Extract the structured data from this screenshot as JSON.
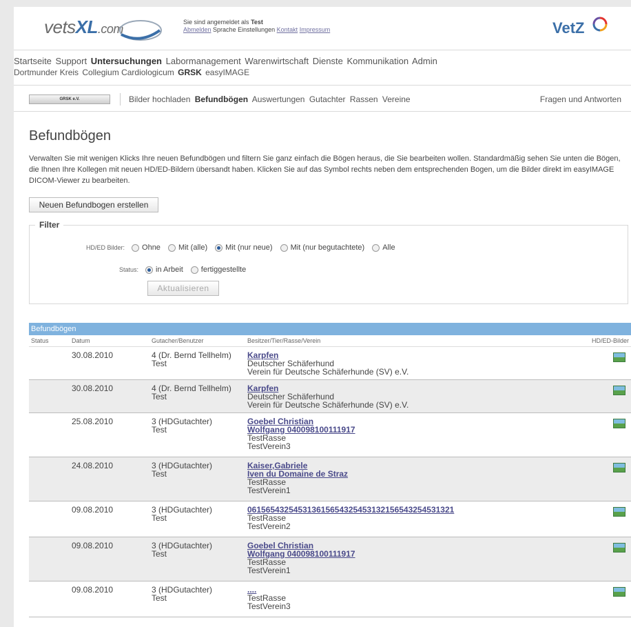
{
  "header": {
    "logo_main": "vets",
    "logo_bold": "XL",
    "logo_suffix": ".com",
    "session_prefix": "Sie sind angemeldet als",
    "session_user": "Test",
    "session_links": [
      "Abmelden",
      "Sprache",
      "Einstellungen",
      "Kontakt",
      "Impressum"
    ],
    "brand": "VetZ"
  },
  "mainnav": {
    "row1": [
      "Startseite",
      "Support",
      "Untersuchungen",
      "Labormanagement",
      "Warenwirtschaft",
      "Dienste",
      "Kommunikation",
      "Admin"
    ],
    "row2": [
      "Dortmunder Kreis",
      "Collegium Cardiologicum",
      "GRSK",
      "easyIMAGE"
    ],
    "active_row1": "Untersuchungen",
    "active_row2": "GRSK"
  },
  "subnav": {
    "badge": "GRSK e.V.",
    "links": [
      "Bilder hochladen",
      "Befundbögen",
      "Auswertungen",
      "Gutachter",
      "Rassen",
      "Vereine"
    ],
    "active": "Befundbögen",
    "faq": "Fragen und Antworten"
  },
  "page": {
    "title": "Befundbögen",
    "intro": "Verwalten Sie mit wenigen Klicks Ihre neuen Befundbögen und filtern Sie ganz einfach die Bögen heraus, die Sie bearbeiten wollen. Standardmäßig sehen Sie unten die Bögen, die Ihnen Ihre Kollegen mit neuen HD/ED-Bildern übersandt haben. Klicken Sie auf das Symbol rechts neben dem entsprechenden Bogen, um die Bilder direkt im easyIMAGE DICOM-Viewer zu bearbeiten.",
    "new_button": "Neuen Befundbogen erstellen"
  },
  "filter": {
    "legend": "Filter",
    "hd_label": "HD/ED Bilder:",
    "hd_options": [
      "Ohne",
      "Mit (alle)",
      "Mit (nur neue)",
      "Mit (nur begutachtete)",
      "Alle"
    ],
    "hd_selected": 2,
    "status_label": "Status:",
    "status_options": [
      "in Arbeit",
      "fertiggestellte"
    ],
    "status_selected": 0,
    "update_button": "Aktualisieren"
  },
  "table": {
    "title": "Befundbögen",
    "columns": [
      "Status",
      "Datum",
      "Gutacher/Benutzer",
      "Besitzer/Tier/Rasse/Verein",
      "HD/ED-Bilder"
    ],
    "rows": [
      {
        "date": "30.08.2010",
        "gutachter": "4 (Dr. Bernd Tellhelm)",
        "user": "Test",
        "links": [
          "Karpfen"
        ],
        "texts": [
          "Deutscher Schäferhund",
          "Verein für Deutsche Schäferhunde (SV) e.V."
        ]
      },
      {
        "date": "30.08.2010",
        "gutachter": "4 (Dr. Bernd Tellhelm)",
        "user": "Test",
        "links": [
          "Karpfen"
        ],
        "texts": [
          "Deutscher Schäferhund",
          "Verein für Deutsche Schäferhunde (SV) e.V."
        ]
      },
      {
        "date": "25.08.2010",
        "gutachter": "3 (HDGutachter)",
        "user": "Test",
        "links": [
          "Goebel Christian",
          "Wolfgang 040098100111917"
        ],
        "texts": [
          "TestRasse",
          "TestVerein3"
        ]
      },
      {
        "date": "24.08.2010",
        "gutachter": "3 (HDGutachter)",
        "user": "Test",
        "links": [
          "Kaiser,Gabriele",
          "Iven du Domaine de Straz"
        ],
        "texts": [
          "TestRasse",
          "TestVerein1"
        ]
      },
      {
        "date": "09.08.2010",
        "gutachter": "3 (HDGutachter)",
        "user": "Test",
        "links": [
          "061565432545313615654325453132156543254531321"
        ],
        "texts": [
          "TestRasse",
          "TestVerein2"
        ]
      },
      {
        "date": "09.08.2010",
        "gutachter": "3 (HDGutachter)",
        "user": "Test",
        "links": [
          "Goebel Christian",
          "Wolfgang 040098100111917"
        ],
        "texts": [
          "TestRasse",
          "TestVerein1"
        ]
      },
      {
        "date": "09.08.2010",
        "gutachter": "3 (HDGutachter)",
        "user": "Test",
        "links": [
          "...."
        ],
        "texts": [
          "TestRasse",
          "TestVerein3"
        ]
      }
    ]
  }
}
